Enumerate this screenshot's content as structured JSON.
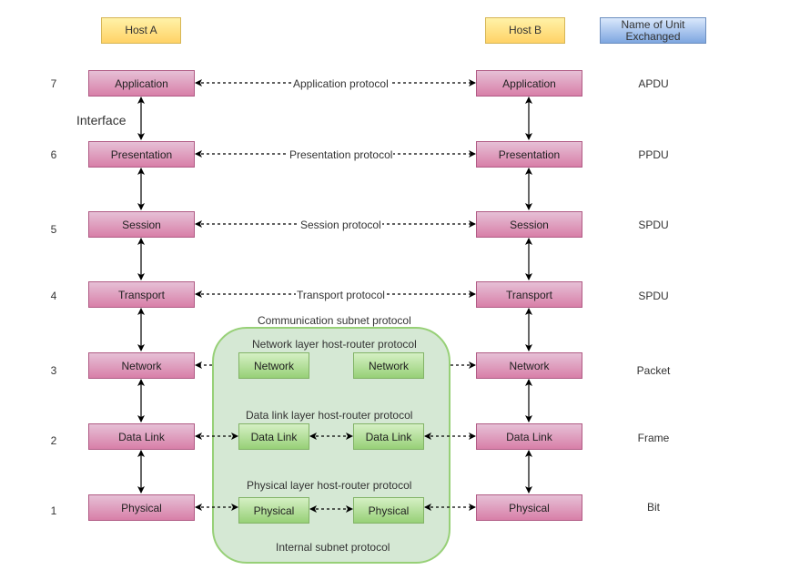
{
  "headers": {
    "host_a": "Host A",
    "host_b": "Host B",
    "unit": "Name of Unit Exchanged"
  },
  "interface_label": "Interface",
  "layers": [
    {
      "number": "7",
      "name": "Application",
      "protocol": "Application protocol",
      "unit": "APDU"
    },
    {
      "number": "6",
      "name": "Presentation",
      "protocol": "Presentation protocol",
      "unit": "PPDU"
    },
    {
      "number": "5",
      "name": "Session",
      "protocol": "Session protocol",
      "unit": "SPDU"
    },
    {
      "number": "4",
      "name": "Transport",
      "protocol": "Transport protocol",
      "unit": "SPDU"
    },
    {
      "number": "3",
      "name": "Network",
      "protocol": "",
      "unit": "Packet"
    },
    {
      "number": "2",
      "name": "Data Link",
      "protocol": "",
      "unit": "Frame"
    },
    {
      "number": "1",
      "name": "Physical",
      "protocol": "",
      "unit": "Bit"
    }
  ],
  "subnet": {
    "title": "Communication subnet protocol",
    "footer": "Internal subnet protocol",
    "network_label": "Network layer host-router protocol",
    "datalink_label": "Data link layer host-router protocol",
    "physical_label": "Physical layer host-router protocol",
    "routers": {
      "network": [
        "Network",
        "Network"
      ],
      "datalink": [
        "Data Link",
        "Data Link"
      ],
      "physical": [
        "Physical",
        "Physical"
      ]
    }
  }
}
